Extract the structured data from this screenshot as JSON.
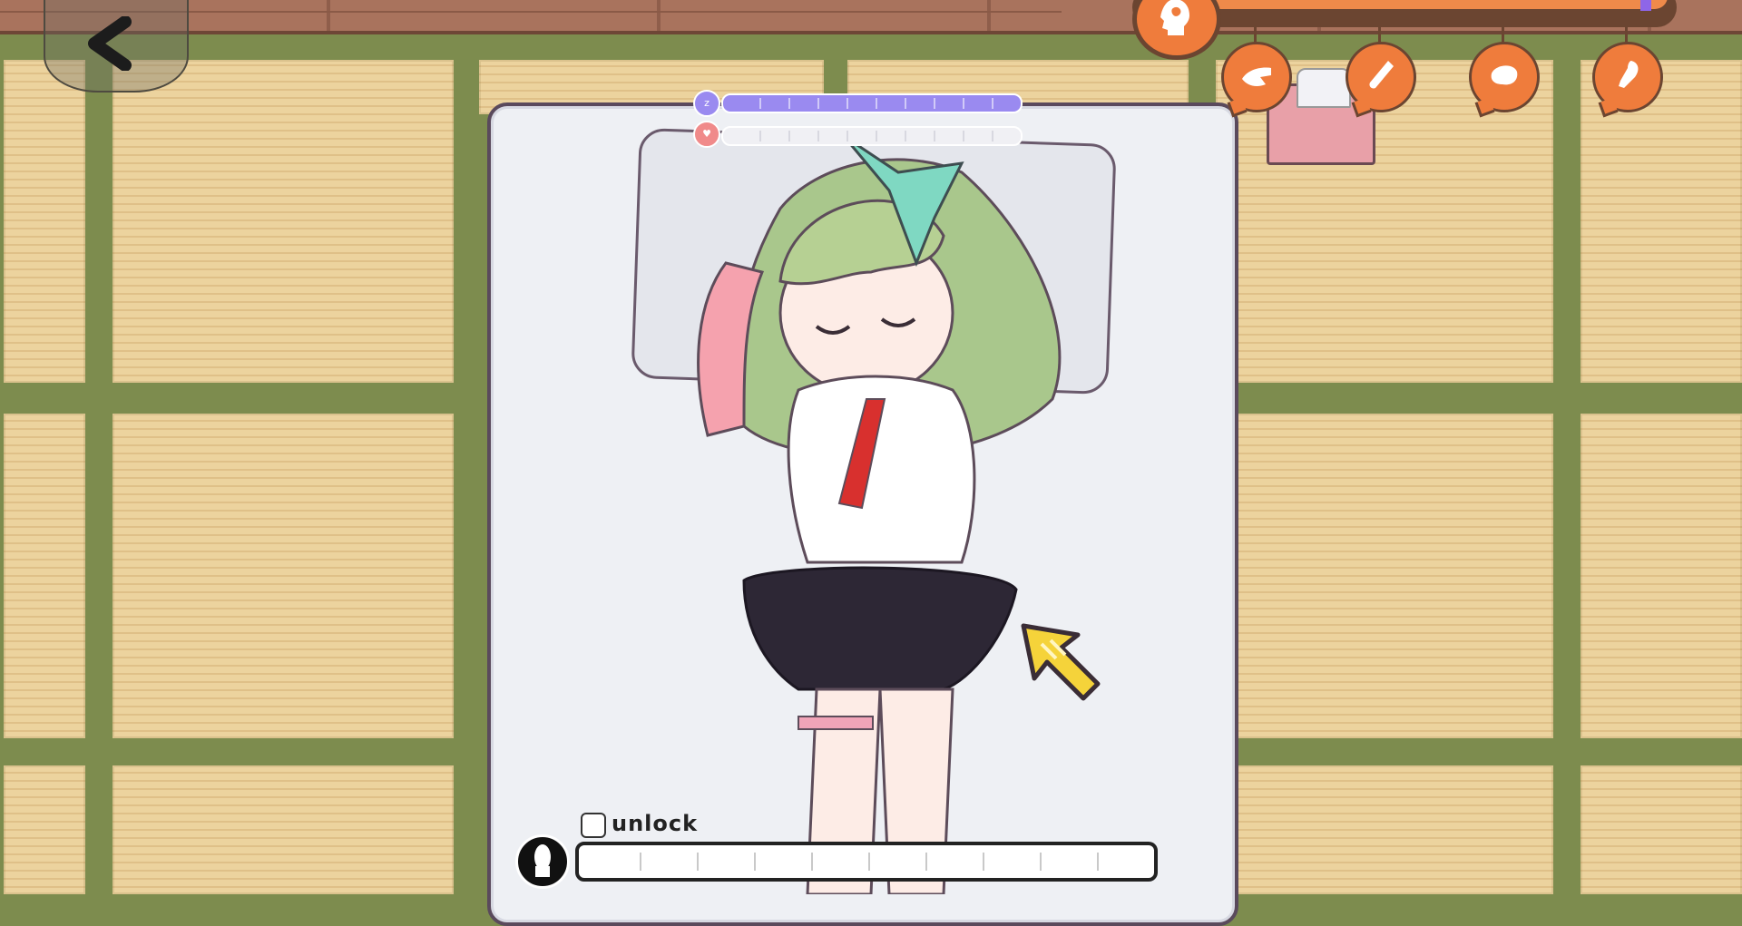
{
  "hud": {
    "back_icon": "chevron-left-icon",
    "excitement_icon": "head-silhouette-icon",
    "excitement_level": 0.97,
    "sleep_icon": "zzz-icon",
    "sleep_level": 1.0,
    "heart_icon": "heart-icon",
    "heart_level": 0.0
  },
  "tools": [
    {
      "name": "hand-icon"
    },
    {
      "name": "finger-icon"
    },
    {
      "name": "tongue-icon"
    },
    {
      "name": "feather-icon"
    }
  ],
  "bottom": {
    "unlock_label": "unlock",
    "unlock_checked": false,
    "progress_icon": "silhouette-icon",
    "progress_level": 0.0
  },
  "colors": {
    "accent_orange": "#ef7c3c",
    "sleep_purple": "#9a8af0",
    "heart_pink": "#f08a8a",
    "tatami": "#ecd39e",
    "border": "#7d8c4e"
  }
}
